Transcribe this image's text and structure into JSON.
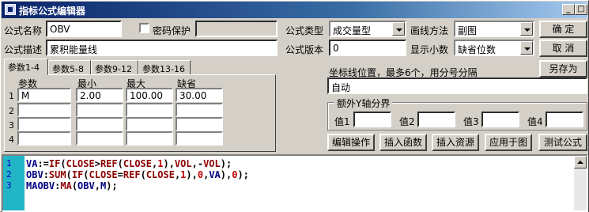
{
  "window": {
    "title": "指标公式编辑器"
  },
  "titlebar_buttons": [
    "_",
    "□",
    "×"
  ],
  "form": {
    "name_label": "公式名称",
    "name_value": "OBV",
    "password_label": "密码保护",
    "desc_label": "公式描述",
    "desc_value": "累积能量线",
    "type_label": "公式类型",
    "type_value": "成交量型",
    "draw_label": "画线方法",
    "draw_value": "副图",
    "version_label": "公式版本",
    "version_value": "0",
    "decimals_label": "显示小数",
    "decimals_value": "缺省位数"
  },
  "buttons": {
    "ok": "确  定",
    "cancel": "取  消",
    "save_as": "另存为",
    "edit_ops": "编辑操作",
    "insert_func": "插入函数",
    "insert_res": "插入资源",
    "apply": "应用于图",
    "test": "测试公式"
  },
  "tabs": [
    "参数1-4",
    "参数5-8",
    "参数9-12",
    "参数13-16"
  ],
  "params": {
    "headers": [
      "参数",
      "最小",
      "最大",
      "缺省"
    ],
    "rows": [
      {
        "num": "1",
        "name": "M",
        "min": "2.00",
        "max": "100.00",
        "default": "30.00"
      },
      {
        "num": "2",
        "name": "",
        "min": "",
        "max": "",
        "default": ""
      },
      {
        "num": "3",
        "name": "",
        "min": "",
        "max": "",
        "default": ""
      },
      {
        "num": "4",
        "name": "",
        "min": "",
        "max": "",
        "default": ""
      }
    ]
  },
  "coords": {
    "label": "坐标线位置，最多6个，用分号分隔",
    "value": "自动"
  },
  "yaxis": {
    "title": "额外Y轴分界",
    "labels": [
      "值1",
      "值2",
      "值3",
      "值4"
    ]
  },
  "editor": {
    "line_numbers": [
      "1",
      "2",
      "3"
    ]
  }
}
